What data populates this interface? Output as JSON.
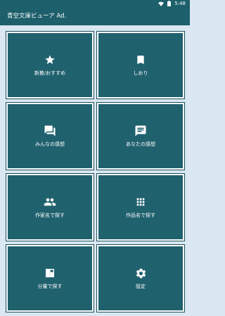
{
  "status_bar": {
    "time": "5:48",
    "icons": [
      "wifi-icon",
      "battery-icon"
    ]
  },
  "app_bar": {
    "title": "青空文庫ビューア Ad."
  },
  "tiles": [
    {
      "label": "新着/おすすめ",
      "icon": "star-icon"
    },
    {
      "label": "しおり",
      "icon": "bookmark-icon"
    },
    {
      "label": "みんなの感想",
      "icon": "forum-icon"
    },
    {
      "label": "あなたの感想",
      "icon": "comment-icon"
    },
    {
      "label": "作家名で探す",
      "icon": "people-icon"
    },
    {
      "label": "作品名で探す",
      "icon": "grid-icon"
    },
    {
      "label": "分量で探す",
      "icon": "dashboard-icon"
    },
    {
      "label": "設定",
      "icon": "gear-icon"
    }
  ],
  "colors": {
    "primary": "#1d5f6b",
    "tile": "#20616e",
    "background": "#dbe7f1"
  }
}
